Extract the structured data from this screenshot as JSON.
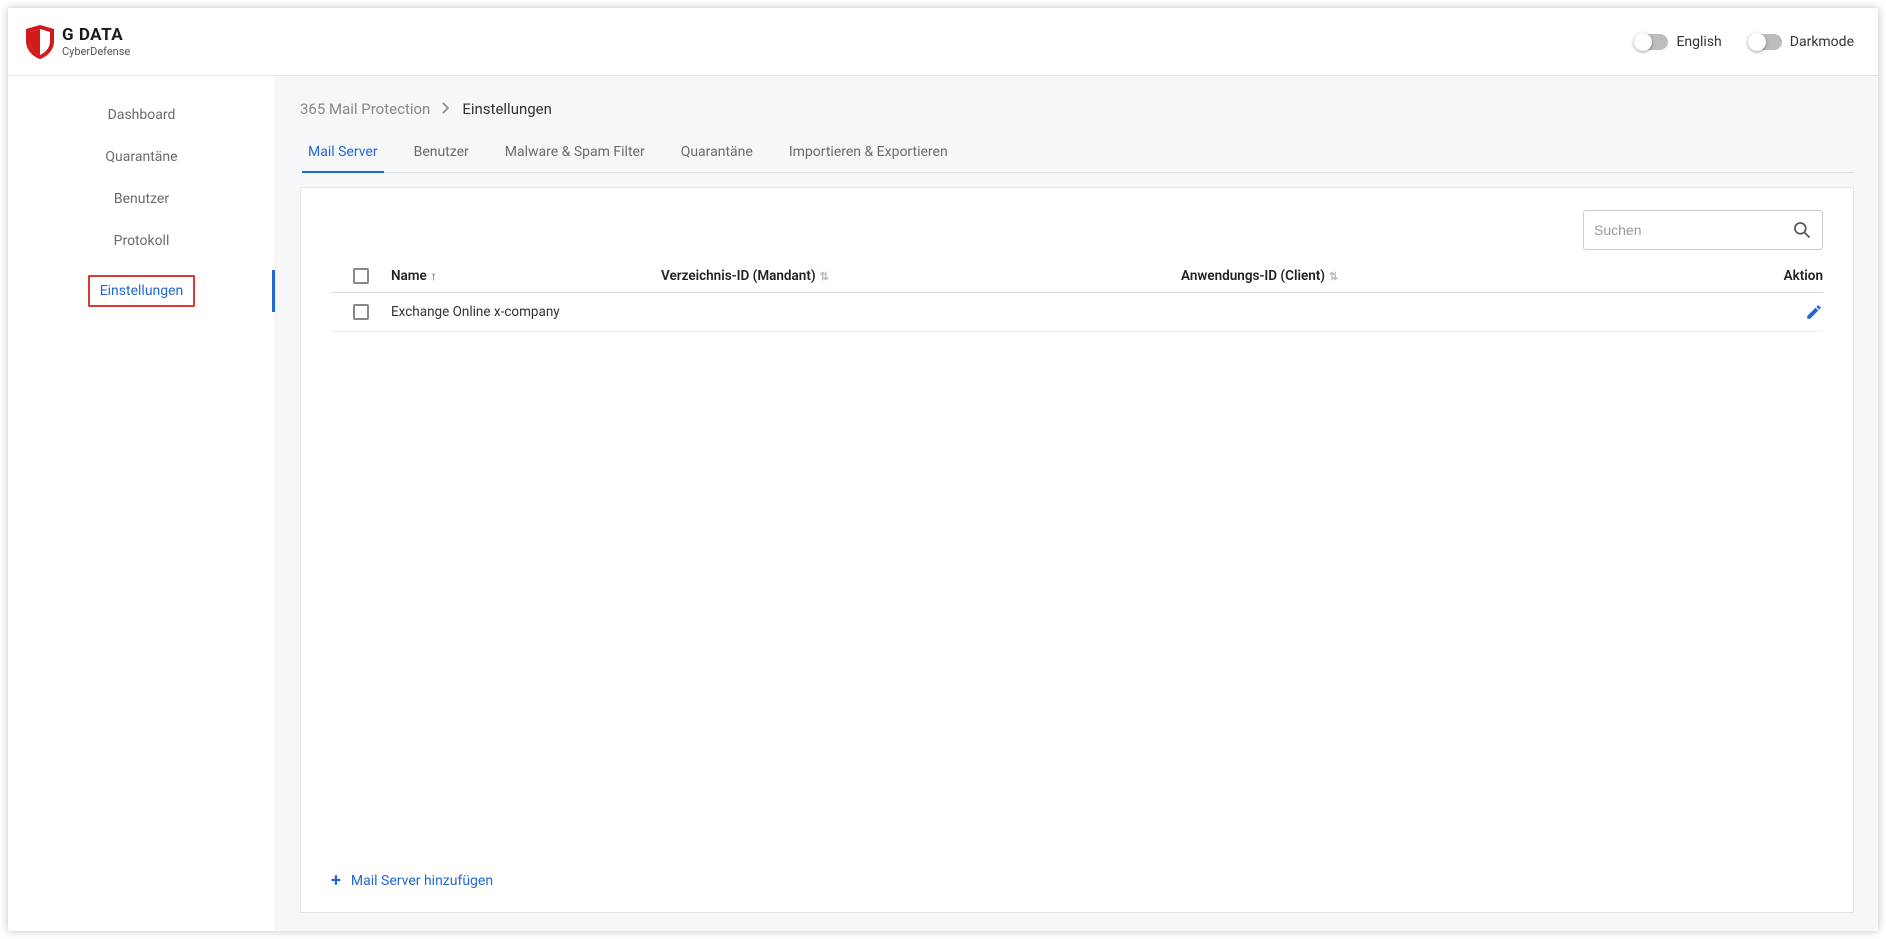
{
  "brand": {
    "name": "G DATA",
    "subtitle": "CyberDefense"
  },
  "header": {
    "english_label": "English",
    "darkmode_label": "Darkmode"
  },
  "sidebar": {
    "items": [
      {
        "label": "Dashboard"
      },
      {
        "label": "Quarantäne"
      },
      {
        "label": "Benutzer"
      },
      {
        "label": "Protokoll"
      },
      {
        "label": "Einstellungen"
      }
    ]
  },
  "breadcrumb": {
    "root": "365 Mail Protection",
    "current": "Einstellungen"
  },
  "tabs": [
    {
      "label": "Mail Server"
    },
    {
      "label": "Benutzer"
    },
    {
      "label": "Malware & Spam Filter"
    },
    {
      "label": "Quarantäne"
    },
    {
      "label": "Importieren & Exportieren"
    }
  ],
  "search": {
    "placeholder": "Suchen"
  },
  "table": {
    "headers": {
      "name": "Name",
      "directory": "Verzeichnis-ID (Mandant)",
      "application": "Anwendungs-ID (Client)",
      "action": "Aktion"
    },
    "rows": [
      {
        "name": "Exchange Online x-company",
        "directory": "",
        "application": ""
      }
    ]
  },
  "footer": {
    "add_label": "Mail Server hinzufügen"
  }
}
